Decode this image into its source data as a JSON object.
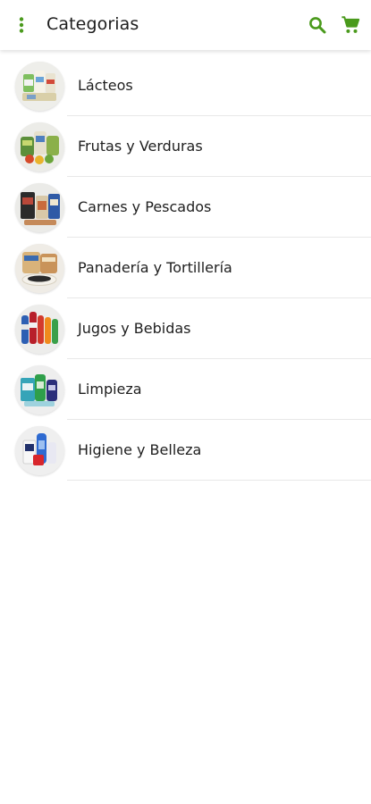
{
  "appbar": {
    "title": "Categorias",
    "menu_icon": "more-vert-icon",
    "search_icon": "search-icon",
    "cart_icon": "shopping-cart-icon"
  },
  "colors": {
    "accent": "#4a9a1c",
    "divider": "#e8e8e8",
    "text": "#1e1e1e"
  },
  "categories": [
    {
      "label": "Lácteos",
      "icon": "dairy-products-image"
    },
    {
      "label": "Frutas y Verduras",
      "icon": "fruits-vegetables-image"
    },
    {
      "label": "Carnes y Pescados",
      "icon": "meat-fish-image"
    },
    {
      "label": "Panadería y Tortillería",
      "icon": "bakery-image"
    },
    {
      "label": "Jugos y Bebidas",
      "icon": "juices-drinks-image"
    },
    {
      "label": "Limpieza",
      "icon": "cleaning-products-image"
    },
    {
      "label": "Higiene y Belleza",
      "icon": "hygiene-beauty-image"
    }
  ]
}
